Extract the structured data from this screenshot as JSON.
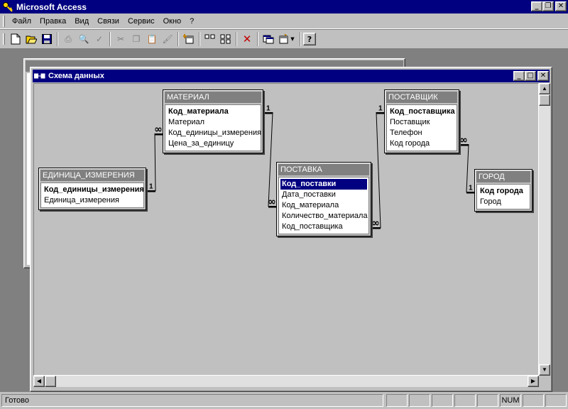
{
  "app": {
    "title": "Microsoft Access"
  },
  "menu": [
    "Файл",
    "Правка",
    "Вид",
    "Связи",
    "Сервис",
    "Окно",
    "?"
  ],
  "schema_window": {
    "title": "Схема данных"
  },
  "tables": [
    {
      "id": "unit",
      "name": "ЕДИНИЦА_ИЗМЕРЕНИЯ",
      "fields": [
        {
          "name": "Код_единицы_измерения",
          "key": true
        },
        {
          "name": "Единица_измерения",
          "key": false
        }
      ]
    },
    {
      "id": "material",
      "name": "МАТЕРИАЛ",
      "fields": [
        {
          "name": "Код_материала",
          "key": true
        },
        {
          "name": "Материал",
          "key": false
        },
        {
          "name": "Код_единицы_измерения",
          "key": false
        },
        {
          "name": "Цена_за_единицу",
          "key": false
        }
      ]
    },
    {
      "id": "supply",
      "name": "ПОСТАВКА",
      "fields": [
        {
          "name": "Код_поставки",
          "key": true,
          "selected": true
        },
        {
          "name": "Дата_поставки",
          "key": false
        },
        {
          "name": "Код_материала",
          "key": false
        },
        {
          "name": "Количество_материала",
          "key": false
        },
        {
          "name": "Код_поставщика",
          "key": false
        }
      ]
    },
    {
      "id": "supplier",
      "name": "ПОСТАВЩИК",
      "fields": [
        {
          "name": "Код_поставщика",
          "key": true
        },
        {
          "name": "Поставщик",
          "key": false
        },
        {
          "name": "Телефон",
          "key": false
        },
        {
          "name": "Код города",
          "key": false
        }
      ]
    },
    {
      "id": "city",
      "name": "ГОРОД",
      "fields": [
        {
          "name": "Код города",
          "key": true
        },
        {
          "name": "Город",
          "key": false
        }
      ]
    }
  ],
  "relationships": [
    {
      "from": "unit.Код_единицы_измерения",
      "to": "material.Код_единицы_измерения",
      "one": "1",
      "many": "∞"
    },
    {
      "from": "material.Код_материала",
      "to": "supply.Код_материала",
      "one": "1",
      "many": "∞"
    },
    {
      "from": "supplier.Код_поставщика",
      "to": "supply.Код_поставщика",
      "one": "1",
      "many": "∞"
    },
    {
      "from": "city.Код города",
      "to": "supplier.Код города",
      "one": "1",
      "many": "∞"
    }
  ],
  "status": {
    "text": "Готово",
    "num": "NUM"
  }
}
